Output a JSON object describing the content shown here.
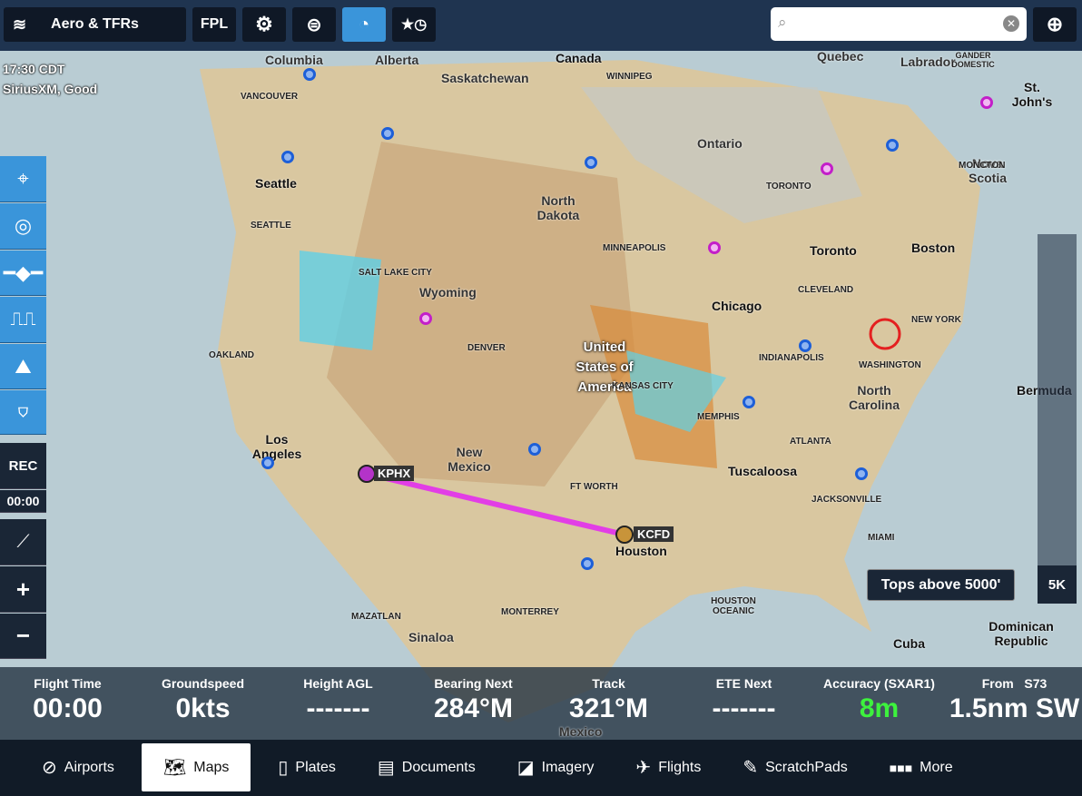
{
  "topbar": {
    "layers_label": "Aero & TFRs",
    "fpl_label": "FPL",
    "search_placeholder": ""
  },
  "status": {
    "time": "17:30 CDT",
    "signal": "SiriusXM, Good"
  },
  "left_toolbar": {
    "rec_label": "REC",
    "rec_time": "00:00"
  },
  "map": {
    "labels_large": [
      "Columbia",
      "Alberta",
      "Saskatchewan",
      "Canada",
      "Quebec",
      "Labrador",
      "Ontario",
      "Seattle",
      "North Dakota",
      "Wyoming",
      "Chicago",
      "Toronto",
      "Boston",
      "United States of America",
      "New Mexico",
      "Los Angeles",
      "Tuscaloosa",
      "Houston",
      "North Carolina",
      "Nova Scotia",
      "St. John's",
      "Bermuda",
      "Cuba",
      "Dominican Republic",
      "Sinaloa",
      "Mexico"
    ],
    "labels_small": [
      "VANCOUVER",
      "WINNIPEG",
      "SEATTLE",
      "SALT LAKE CITY",
      "MINNEAPOLIS",
      "TORONTO",
      "CLEVELAND",
      "NEW YORK",
      "WASHINGTON",
      "DENVER",
      "KANSAS CITY",
      "INDIANAPOLIS",
      "OAKLAND",
      "MEMPHIS",
      "ATLANTA",
      "FT WORTH",
      "JACKSONVILLE",
      "MIAMI",
      "HOUSTON OCEANIC",
      "MONTERREY",
      "MAZATLAN",
      "GANDER DOMESTIC",
      "MONCTON"
    ],
    "route": {
      "from": "KPHX",
      "to": "KCFD",
      "color": "#e23ee6"
    },
    "tooltip": "Tops above 5000'",
    "altitude_label": "5K"
  },
  "instruments": [
    {
      "key": "Flight Time",
      "value": "00:00"
    },
    {
      "key": "Groundspeed",
      "value": "0kts"
    },
    {
      "key": "Height AGL",
      "value": "-------"
    },
    {
      "key": "Bearing Next",
      "value": "284°M"
    },
    {
      "key": "Track",
      "value": "321°M"
    },
    {
      "key": "ETE Next",
      "value": "-------"
    },
    {
      "key": "Accuracy (SXAR1)",
      "value": "8m",
      "color": "#3df23d"
    },
    {
      "key": "From   S73",
      "value": "1.5nm SW"
    }
  ],
  "tabs": [
    {
      "label": "Airports",
      "icon": "airport-icon"
    },
    {
      "label": "Maps",
      "icon": "map-icon",
      "selected": true
    },
    {
      "label": "Plates",
      "icon": "plates-icon"
    },
    {
      "label": "Documents",
      "icon": "documents-icon"
    },
    {
      "label": "Imagery",
      "icon": "imagery-icon"
    },
    {
      "label": "Flights",
      "icon": "flights-icon"
    },
    {
      "label": "ScratchPads",
      "icon": "pencil-icon"
    },
    {
      "label": "More",
      "icon": "more-icon"
    }
  ],
  "colors": {
    "accent": "#3a95da",
    "topbar": "#1f3450",
    "tabbar": "#111b27"
  }
}
